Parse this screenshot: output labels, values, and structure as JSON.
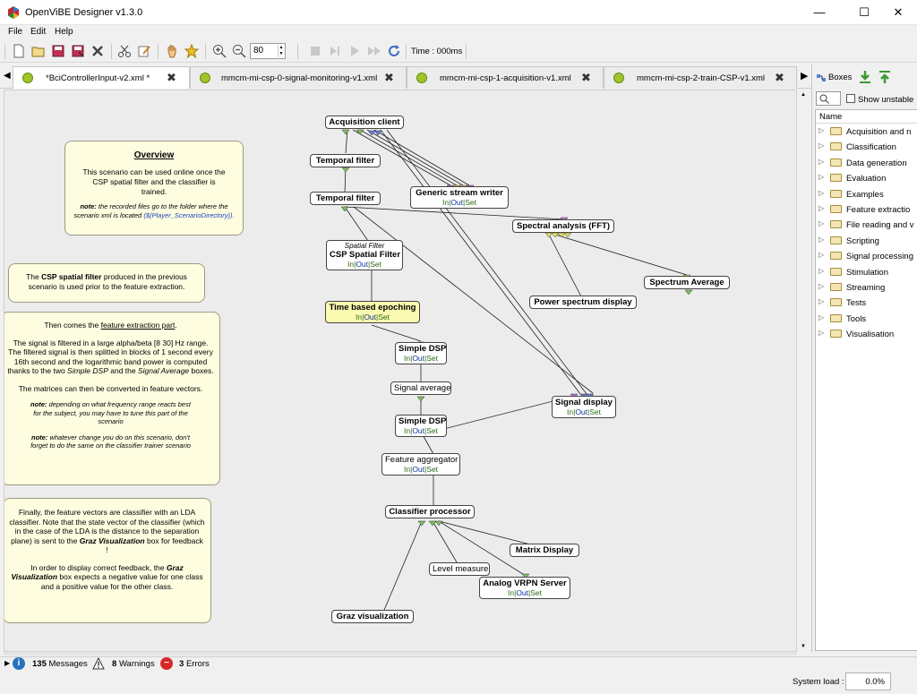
{
  "window": {
    "title": "OpenViBE Designer v1.3.0",
    "minimize": "—",
    "maximize": "☐",
    "close": "✕"
  },
  "menu": {
    "file": "File",
    "edit": "Edit",
    "help": "Help"
  },
  "toolbar": {
    "zoom_value": "80",
    "time_label": "Time : 000ms"
  },
  "tabs": [
    {
      "label": "*BciControllerInput-v2.xml *",
      "active": true
    },
    {
      "label": "mmcm-mi-csp-0-signal-monitoring-v1.xml",
      "active": false
    },
    {
      "label": "mmcm-mi-csp-1-acquisition-v1.xml",
      "active": false
    },
    {
      "label": "mmcm-mi-csp-2-train-CSP-v1.xml",
      "active": false
    }
  ],
  "tab_close": "✖",
  "notes": {
    "overview": {
      "heading": "Overview",
      "text": "This scenario can be used online once the CSP spatial filter and the classifier is trained.",
      "note_label": "note:",
      "note_text": "the recorded files go to the folder where the scenario xml is located",
      "note_path": "(${Player_ScenarioDirectory})."
    },
    "csp": {
      "pre": "The ",
      "bold": "CSP spatial filter",
      "post": " produced in the previous scenario is used prior to the feature extraction."
    },
    "features": {
      "line1_pre": "Then comes the ",
      "line1_link": "feature extraction part",
      "line1_post": ".",
      "para1_a": "The signal is filtered in a large alpha/beta [8 30] Hz range. The filtered signal is then splitted in blocks of 1 second every 16th second and the logarithmic band power is computed thanks to the two ",
      "para1_i1": "Simple DSP",
      "para1_b": " and the ",
      "para1_i2": "Signal Average",
      "para1_c": " boxes.",
      "para2": "The matrices can then be converted in feature vectors.",
      "note1_label": "note:",
      "note1_text": "depending on what frequency range reacts best for the subject, you may have to tune this part of the scenario",
      "note2_label": "note:",
      "note2_text": "whatever change you do on this scenario, don't forget to do the same on the classifier trainer scenario"
    },
    "classifier": {
      "para1_a": "Finally, the feature vectors are classifier with an LDA classifier. Note that the state vector of the classifier (which in the case of the LDA is the distance to the separation plane) is sent to the ",
      "para1_b": "Graz Visualization",
      "para1_c": " box for feedback !",
      "para2_a": "In order to display correct feedback, the ",
      "para2_b": "Graz Visualization",
      "para2_c": " box expects a negative value for one class and a positive value for the other class."
    }
  },
  "settings_labels": {
    "in": "In",
    "out": "Out",
    "set": "Set",
    "sep": "|"
  },
  "graph_boxes": {
    "acquisition_client": "Acquisition client",
    "temporal_filter_1": "Temporal filter",
    "temporal_filter_2": "Temporal filter",
    "generic_stream_writer": "Generic stream writer",
    "spectral_analysis": "Spectral analysis (FFT)",
    "spatial_filter_sub": "Spatial Filter",
    "csp_spatial_filter": "CSP Spatial Filter",
    "spectrum_average": "Spectrum Average",
    "power_spectrum_display": "Power spectrum display",
    "time_based_epoching": "Time based epoching",
    "simple_dsp_1": "Simple DSP",
    "signal_average": "Signal average",
    "signal_display": "Signal display",
    "simple_dsp_2": "Simple DSP",
    "feature_aggregator": "Feature aggregator",
    "classifier_processor": "Classifier processor",
    "matrix_display": "Matrix Display",
    "level_measure": "Level measure",
    "analog_vrpn_server": "Analog VRPN Server",
    "graz_visualization": "Graz visualization"
  },
  "boxes_panel": {
    "title": "Boxes",
    "show_unstable": "Show unstable",
    "column": "Name",
    "categories": [
      "Acquisition and n",
      "Classification",
      "Data generation",
      "Evaluation",
      "Examples",
      "Feature extractio",
      "File reading and v",
      "Scripting",
      "Signal processing",
      "Stimulation",
      "Streaming",
      "Tests",
      "Tools",
      "Visualisation"
    ]
  },
  "status": {
    "messages_count": "135",
    "messages_label": "Messages",
    "warnings_count": "8",
    "warnings_label": "Warnings",
    "errors_count": "3",
    "errors_label": "Errors",
    "system_load_label": "System load :",
    "system_load_value": "0.0%"
  },
  "colors": {
    "note_bg": "#fffde0",
    "selected_box": "#fafab0",
    "input_port": "#c070d0",
    "output_port": "#80c060",
    "stim_port": "#6b7be0"
  }
}
